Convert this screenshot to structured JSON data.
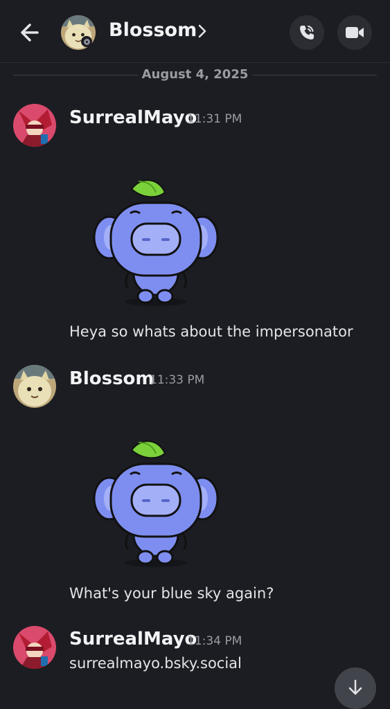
{
  "header": {
    "title": "Blossom",
    "icons": {
      "back": "arrow-left-icon",
      "chevron": "chevron-right-icon",
      "call": "phone-icon",
      "video": "video-camera-icon",
      "status": "idle-status-icon"
    }
  },
  "date_divider": "August 4, 2025",
  "messages": [
    {
      "author": "SurrealMayo",
      "time": "11:31 PM",
      "sticker": "wumpus-leaf-sticker",
      "text": "Heya so whats about the impersonator"
    },
    {
      "author": "Blossom",
      "time": "11:33 PM",
      "sticker": "wumpus-leaf-sticker",
      "text": "What's your blue sky again?"
    },
    {
      "author": "SurrealMayo",
      "time": "11:34 PM",
      "text": "surrealmayo.bsky.social"
    }
  ],
  "colors": {
    "background": "#1c1d22",
    "button": "#2b2d33",
    "muted_text": "#9a9ca4",
    "wumpus": "#7e8ef0"
  }
}
